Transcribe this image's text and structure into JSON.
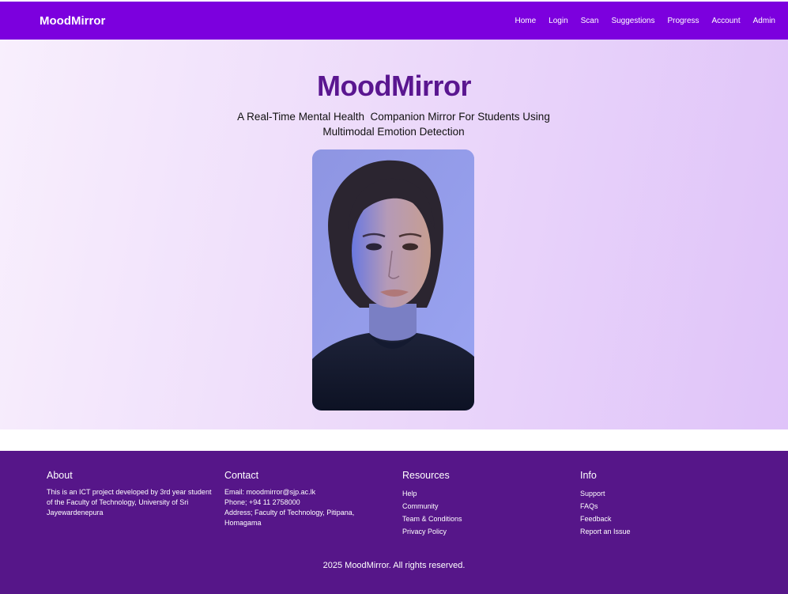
{
  "nav": {
    "brand": "MoodMirror",
    "links": [
      "Home",
      "Login",
      "Scan",
      "Suggestions",
      "Progress",
      "Account",
      "Admin"
    ]
  },
  "hero": {
    "title": "MoodMirror",
    "subtitle": "A Real-Time Mental Health  Companion Mirror For Students Using Multimodal Emotion Detection"
  },
  "footer": {
    "about": {
      "heading": "About",
      "text": "This is an ICT project developed by 3rd year student of the Faculty of Technology, University of Sri Jayewardenepura"
    },
    "contact": {
      "heading": "Contact",
      "email": "Email: moodmirror@sjp.ac.lk",
      "phone": "Phone; +94 11 2758000",
      "address": "Address; Faculty of Technology, Pitipana, Homagama"
    },
    "resources": {
      "heading": "Resources",
      "links": [
        "Help",
        "Community",
        "Team & Conditions",
        "Privacy Policy"
      ]
    },
    "info": {
      "heading": "Info",
      "links": [
        "Support",
        "FAQs",
        "Feedback",
        "Report an Issue"
      ]
    },
    "copyright": "2025 MoodMirror. All rights reserved."
  },
  "colors": {
    "nav_bg": "#7c00de",
    "title": "#5a1690",
    "footer_bg": "#561689"
  }
}
